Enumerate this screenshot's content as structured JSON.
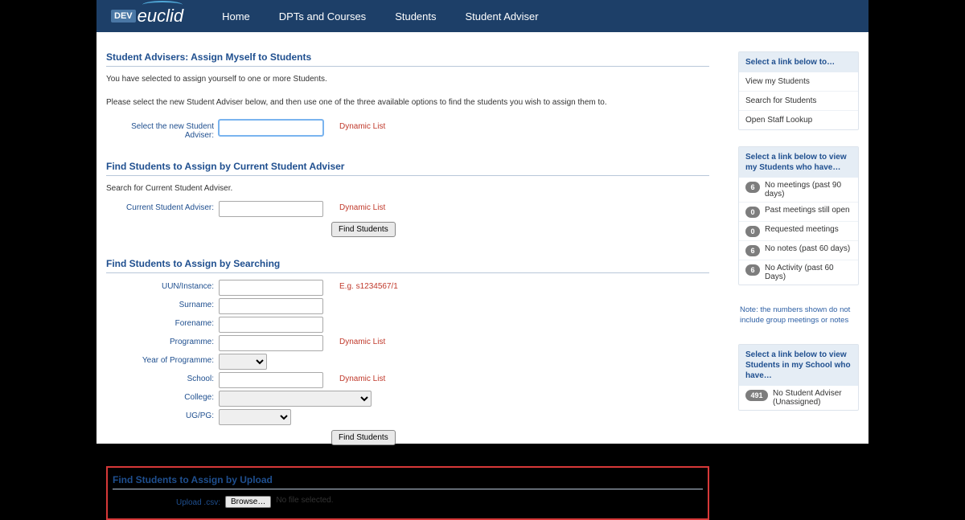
{
  "header": {
    "logo_dev": "DEV",
    "logo_text": "euclid",
    "nav": [
      "Home",
      "DPTs and Courses",
      "Students",
      "Student Adviser"
    ]
  },
  "main": {
    "title": "Student Advisers: Assign Myself to Students",
    "intro1": "You have selected to assign yourself to one or more Students.",
    "intro2": "Please select the new Student Adviser below, and then use one of the three available options to find the students you wish to assign them to.",
    "select_new": {
      "label": "Select the new Student Adviser:",
      "hint": "Dynamic List"
    },
    "find_by_adviser": {
      "title": "Find Students to Assign by Current Student Adviser",
      "desc": "Search for Current Student Adviser.",
      "label": "Current Student Adviser:",
      "hint": "Dynamic List",
      "button": "Find Students"
    },
    "find_search": {
      "title": "Find Students to Assign by Searching",
      "uun_label": "UUN/Instance:",
      "uun_hint": "E.g. s1234567/1",
      "surname_label": "Surname:",
      "forename_label": "Forename:",
      "programme_label": "Programme:",
      "programme_hint": "Dynamic List",
      "yop_label": "Year of Programme:",
      "school_label": "School:",
      "school_hint": "Dynamic List",
      "college_label": "College:",
      "ugpg_label": "UG/PG:",
      "button": "Find Students"
    },
    "upload": {
      "title": "Find Students to Assign by Upload",
      "label": "Upload .csv:",
      "browse": "Browse…",
      "status": "No file selected."
    }
  },
  "sidebar": {
    "panel1": {
      "head": "Select a link below to…",
      "links": [
        "View my Students",
        "Search for Students",
        "Open Staff Lookup"
      ]
    },
    "panel2": {
      "head": "Select a link below to view my Students who have…",
      "items": [
        {
          "count": "6",
          "label": "No meetings (past 90 days)"
        },
        {
          "count": "0",
          "label": "Past meetings still open"
        },
        {
          "count": "0",
          "label": "Requested meetings"
        },
        {
          "count": "6",
          "label": "No notes (past 60 days)"
        },
        {
          "count": "6",
          "label": "No Activity (past 60 Days)"
        }
      ],
      "note": "Note: the numbers shown do not include group meetings or notes"
    },
    "panel3": {
      "head": "Select a link below to view Students in my School who have…",
      "items": [
        {
          "count": "491",
          "label": "No Student Adviser (Unassigned)"
        }
      ]
    }
  }
}
